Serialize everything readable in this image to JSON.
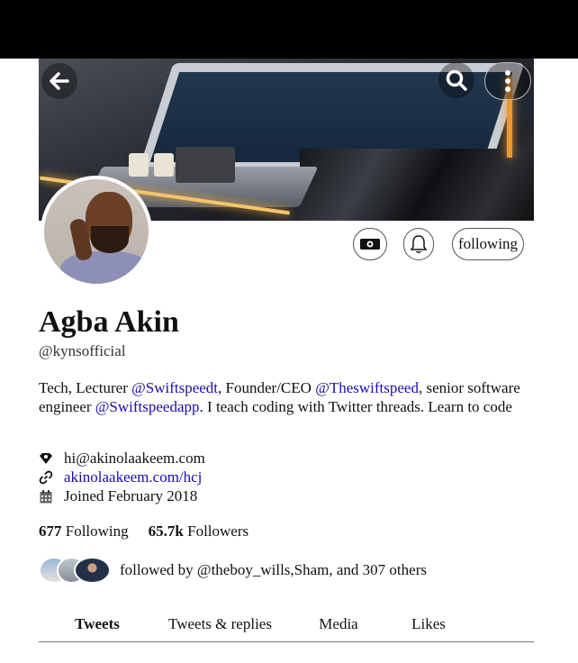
{
  "profile": {
    "name": "Agba Akin",
    "handle": "@kynsofficial",
    "bio": {
      "p1": "Tech, Lecturer ",
      "l1": "@Swiftspeedt",
      "p2": ", Founder/CEO ",
      "l2": "@Theswiftspeed",
      "p3": ", senior software engineer ",
      "l3": "@Swiftspeedapp",
      "p4": ". I teach coding with Twitter threads. Learn to code"
    },
    "email": "hi@akinolaakeem.com",
    "website": "akinolaakeem.com/hcj",
    "joined": "Joined February 2018"
  },
  "actions": {
    "follow_label": "following"
  },
  "stats": {
    "following_count": "677",
    "following_label": " Following",
    "followers_count": "65.7k",
    "followers_label": " Followers"
  },
  "followed_by": "followed by @theboy_wills,Sham, and 307 others",
  "tabs": [
    {
      "label": "Tweets",
      "active": true
    },
    {
      "label": "Tweets & replies",
      "active": false
    },
    {
      "label": "Media",
      "active": false
    },
    {
      "label": "Likes",
      "active": false
    }
  ],
  "icons": {
    "back": "back-arrow-icon",
    "search": "search-icon",
    "more": "more-vertical-icon",
    "tip": "money-icon",
    "notify": "bell-icon",
    "email": "location-pin-icon",
    "website": "link-icon",
    "joined": "calendar-icon"
  },
  "colors": {
    "link": "#1a0dab",
    "background": "#ffffff",
    "topbar": "#000000"
  }
}
